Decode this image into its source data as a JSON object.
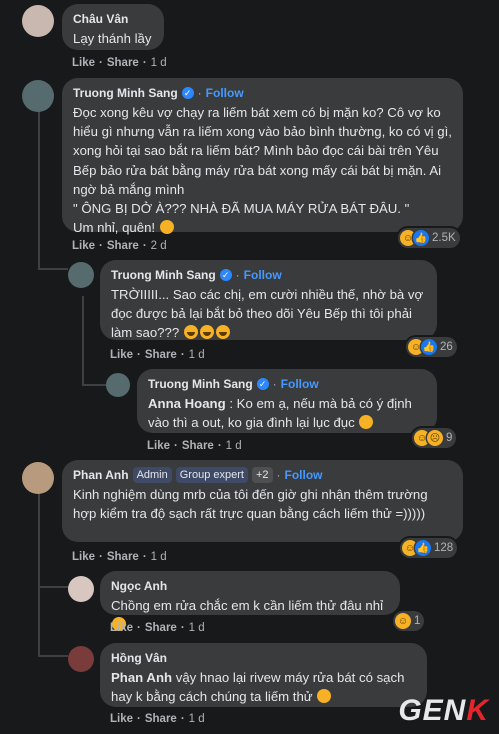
{
  "comments": [
    {
      "author": "Châu Vân",
      "text": "Lạy thánh lầy",
      "like": "Like",
      "share": "Share",
      "time": "1 d"
    },
    {
      "author": "Truong Minh Sang",
      "follow": "Follow",
      "text": "Đọc xong kêu vợ chạy ra liếm bát xem có bị mặn ko? Cô vợ ko hiểu gì nhưng vẫn ra liếm xong vào bảo bình thường, ko có vị gì, xong hỏi tại sao bắt ra liếm bát? Mình bảo đọc cái bài trên Yêu Bếp bảo rửa bát bằng máy rửa bát xong mấy cái bát bị mặn. Ai ngờ bả mắng mình\n\" ÔNG BỊ DỞ À??? NHÀ ĐÃ MUA MÁY RỬA BÁT ĐÂU. \"\nUm nhỉ, quên!",
      "like": "Like",
      "share": "Share",
      "time": "2 d",
      "reaction_count": "2.5K"
    },
    {
      "author": "Truong Minh Sang",
      "follow": "Follow",
      "text": "TRỜIIIII... Sao các chị, em cười nhiều thế, nhờ bà vợ đọc được bả lại bắt bỏ theo dõi Yêu Bếp thì tôi phải làm sao???",
      "like": "Like",
      "share": "Share",
      "time": "1 d",
      "reaction_count": "26"
    },
    {
      "author": "Truong Minh Sang",
      "follow": "Follow",
      "mention": "Anna Hoang",
      "text": " : Ko em ạ, nếu mà bả có ý định vào thì a out, ko gia đình lại lục đục",
      "like": "Like",
      "share": "Share",
      "time": "1 d",
      "reaction_count": "9"
    },
    {
      "author": "Phan Anh",
      "badges": [
        "Admin",
        "Group expert",
        "+2"
      ],
      "follow": "Follow",
      "text": "Kinh nghiệm dùng mrb của tôi đến giờ ghi nhận thêm trường hợp kiểm tra độ sạch rất trực quan bằng cách liếm thử =)))))",
      "like": "Like",
      "share": "Share",
      "time": "1 d",
      "reaction_count": "128"
    },
    {
      "author": "Ngọc Anh",
      "text": "Chồng em rửa chắc em k cần liếm thử đâu nhỉ",
      "like": "Like",
      "share": "Share",
      "time": "1 d",
      "reaction_count": "1"
    },
    {
      "author": "Hồng Vân",
      "mention": "Phan Anh",
      "text": " vậy hnao lại rivew máy rửa bát có sạch hay k bằng cách chúng ta liếm thử",
      "like": "Like",
      "share": "Share",
      "time": "1 d"
    }
  ],
  "separator": "·",
  "watermark": {
    "main": "GEN",
    "accent": "K"
  },
  "colors": {
    "background": "#18191a",
    "bubble": "#3a3b3c",
    "follow": "#4599ff",
    "like_reaction": "#1877f2",
    "haha_reaction": "#f7b125"
  }
}
